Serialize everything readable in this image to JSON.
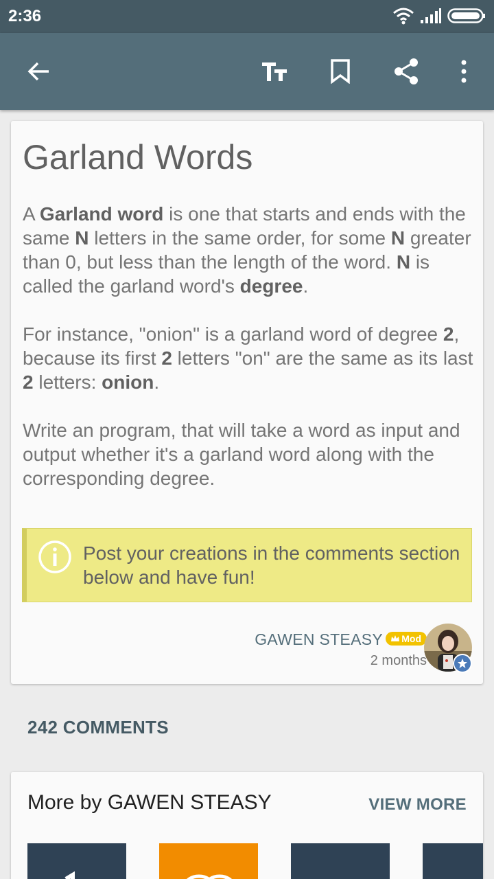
{
  "status_bar": {
    "time": "2:36"
  },
  "toolbar": {
    "back_icon": "arrow-back-icon",
    "text_size_icon": "text-size-icon",
    "text_size_label": "TT",
    "bookmark_icon": "bookmark-icon",
    "share_icon": "share-icon",
    "more_icon": "more-vert-icon"
  },
  "post": {
    "title": "Garland Words",
    "p1": {
      "t1": "A ",
      "b1": "Garland word",
      "t2": " is one that starts and ends with the same ",
      "b2": "N",
      "t3": " letters in the same order, for some ",
      "b3": "N",
      "t4": " greater than 0, but less than the length of the word. ",
      "b4": "N",
      "t5": " is called the garland word's ",
      "b5": "degree",
      "t6": "."
    },
    "p2": {
      "t1": "For instance, \"onion\" is a garland word of degree ",
      "b1": "2",
      "t2": ", because its first ",
      "b2": "2",
      "t3": " letters \"on\" are the same as its last ",
      "b3": "2",
      "t4": " letters: ",
      "b4": "onion",
      "t5": "."
    },
    "p3": "Write an program, that will take a word as input and output whether it's a garland word along with the corresponding degree.",
    "note": "Post your creations in the comments section below and have fun!",
    "author": "GAWEN STEASY",
    "badge": "Mod",
    "time_ago": "2 months"
  },
  "comments": {
    "count_label": "242 COMMENTS"
  },
  "more_by": {
    "title": "More by GAWEN STEASY",
    "view_more": "VIEW MORE",
    "thumb_colors": [
      "#2f4255",
      "#f28c00",
      "#2f4255",
      "#2f4255"
    ]
  },
  "colors": {
    "app_bar": "#546e7a",
    "status_bar": "#455a64",
    "note_bg": "#eeea86",
    "badge": "#f2c200"
  }
}
